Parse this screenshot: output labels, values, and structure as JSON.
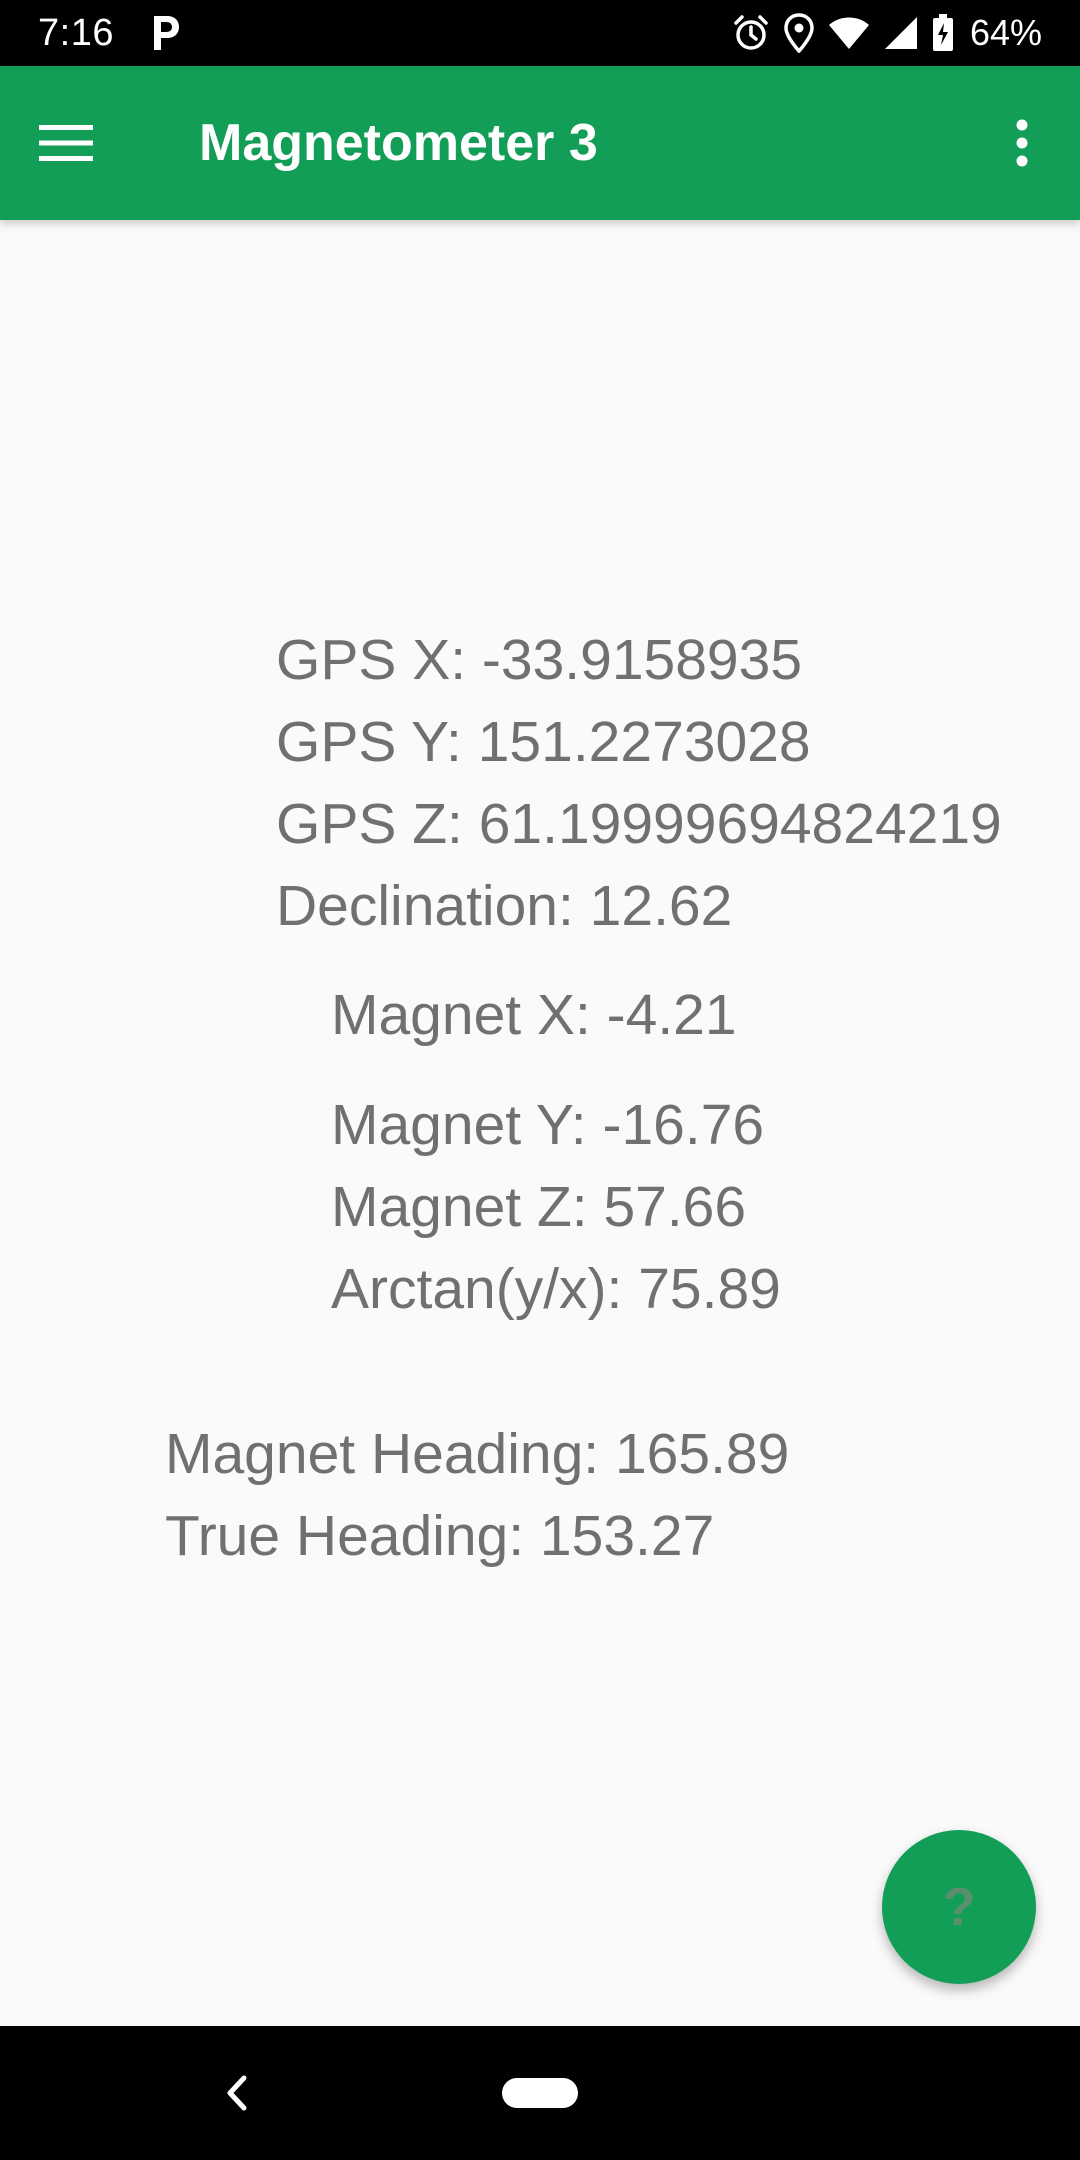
{
  "status_bar": {
    "time": "7:16",
    "battery": "64%",
    "icons": [
      "parking-icon",
      "alarm-icon",
      "location-icon",
      "wifi-icon",
      "signal-icon",
      "battery-icon"
    ]
  },
  "app_bar": {
    "title": "Magnetometer 3",
    "background_color": "#139e57",
    "icons": [
      "menu-icon",
      "more-vert-icon"
    ]
  },
  "readouts": {
    "gps_x": "GPS X: -33.9158935",
    "gps_y": "GPS Y: 151.2273028",
    "gps_z": "GPS Z: 61.19999694824219",
    "declination": "Declination: 12.62",
    "magnet_x": "Magnet X: -4.21",
    "magnet_y": "Magnet Y: -16.76",
    "magnet_z": "Magnet Z: 57.66",
    "arctan": "Arctan(y/x): 75.89",
    "magnet_heading": "Magnet Heading: 165.89",
    "true_heading": "True Heading: 153.27"
  },
  "fab": {
    "label": "?",
    "color": "#139e57"
  },
  "nav_bar": {
    "icons": [
      "back-icon",
      "home-pill"
    ]
  }
}
